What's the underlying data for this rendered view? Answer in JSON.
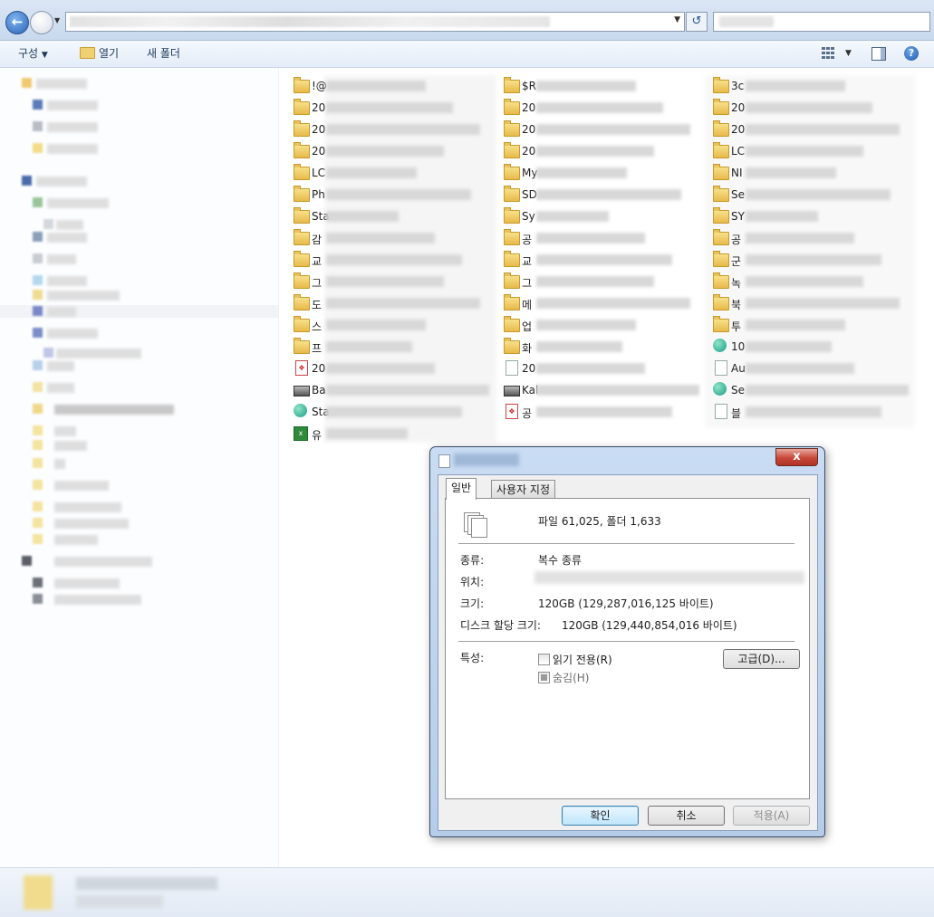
{
  "toolbar": {
    "organize": "구성",
    "open": "열기",
    "new_folder": "새 폴더"
  },
  "files": {
    "col1": [
      {
        "name": "!@",
        "type": "folder"
      },
      {
        "name": "20",
        "type": "folder"
      },
      {
        "name": "20",
        "type": "folder"
      },
      {
        "name": "20",
        "type": "folder"
      },
      {
        "name": "LC",
        "type": "folder"
      },
      {
        "name": "Ph",
        "type": "folder"
      },
      {
        "name": "Sta",
        "type": "folder"
      },
      {
        "name": "감",
        "type": "folder"
      },
      {
        "name": "교",
        "type": "folder"
      },
      {
        "name": "그",
        "type": "folder"
      },
      {
        "name": "도",
        "type": "folder"
      },
      {
        "name": "스",
        "type": "folder"
      },
      {
        "name": "프",
        "type": "folder"
      },
      {
        "name": "20",
        "type": "pdf"
      },
      {
        "name": "Ba",
        "type": "drive"
      },
      {
        "name": "Sta",
        "type": "app"
      },
      {
        "name": "유",
        "type": "xls"
      }
    ],
    "col2": [
      {
        "name": "$R",
        "type": "folder"
      },
      {
        "name": "20",
        "type": "folder"
      },
      {
        "name": "20",
        "type": "folder"
      },
      {
        "name": "20",
        "type": "folder"
      },
      {
        "name": "My",
        "type": "folder"
      },
      {
        "name": "SD",
        "type": "folder"
      },
      {
        "name": "Sy",
        "type": "folder"
      },
      {
        "name": "공",
        "type": "folder"
      },
      {
        "name": "교",
        "type": "folder"
      },
      {
        "name": "그",
        "type": "folder"
      },
      {
        "name": "메",
        "type": "folder"
      },
      {
        "name": "업",
        "type": "folder"
      },
      {
        "name": "화",
        "type": "folder"
      },
      {
        "name": "20",
        "type": "doc"
      },
      {
        "name": "Kal",
        "type": "drive"
      },
      {
        "name": "공",
        "type": "pdf"
      }
    ],
    "col3": [
      {
        "name": "3c",
        "type": "folder"
      },
      {
        "name": "20",
        "type": "folder"
      },
      {
        "name": "20",
        "type": "folder"
      },
      {
        "name": "LC",
        "type": "folder"
      },
      {
        "name": "NI",
        "type": "folder"
      },
      {
        "name": "Se",
        "type": "folder"
      },
      {
        "name": "SY",
        "type": "folder"
      },
      {
        "name": "공",
        "type": "folder"
      },
      {
        "name": "군",
        "type": "folder"
      },
      {
        "name": "녹",
        "type": "folder"
      },
      {
        "name": "북",
        "type": "folder"
      },
      {
        "name": "투",
        "type": "folder"
      },
      {
        "name": "10",
        "type": "app"
      },
      {
        "name": "Au",
        "type": "doc"
      },
      {
        "name": "Se",
        "type": "app"
      },
      {
        "name": "블",
        "type": "doc"
      }
    ]
  },
  "dialog": {
    "close": "x",
    "tabs": {
      "general": "일반",
      "custom": "사용자 지정"
    },
    "summary": "파일 61,025, 폴더 1,633",
    "type_label": "종류:",
    "type_value": "복수 종류",
    "location_label": "위치:",
    "size_label": "크기:",
    "size_value": "120GB (129,287,016,125 바이트)",
    "disk_label": "디스크 할당 크기:",
    "disk_value": "120GB (129,440,854,016 바이트)",
    "attr_label": "특성:",
    "readonly_label": "읽기 전용(R)",
    "hidden_label": "숨김(H)",
    "advanced": "고급(D)...",
    "ok": "확인",
    "cancel": "취소",
    "apply": "적용(A)"
  }
}
